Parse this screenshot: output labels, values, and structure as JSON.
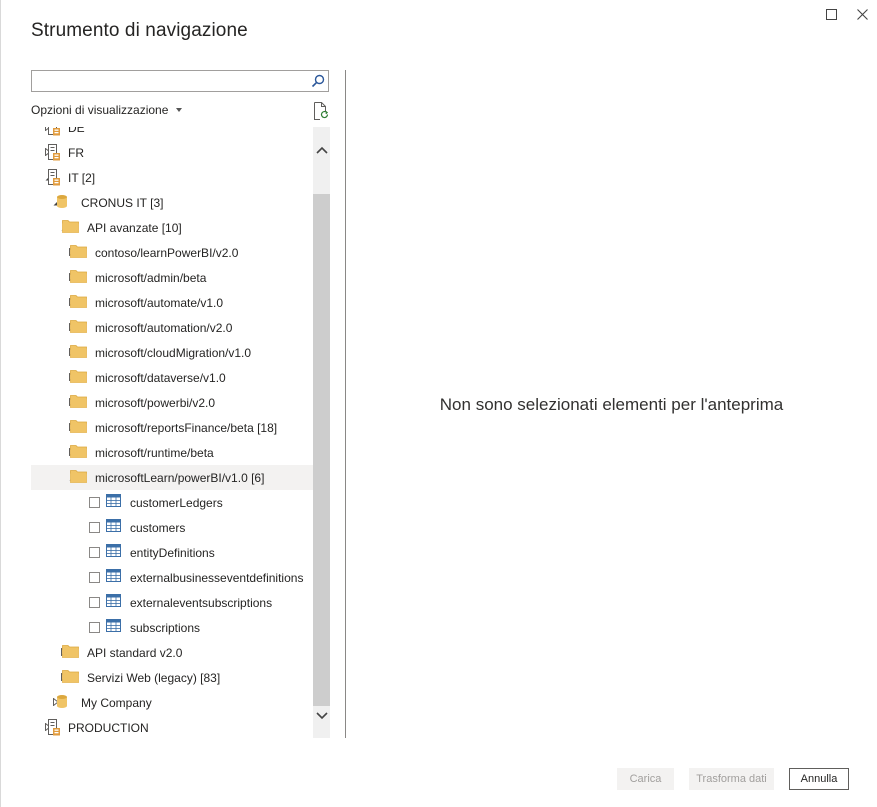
{
  "window": {
    "title": "Strumento di navigazione",
    "maximize_icon": "maximize-icon",
    "close_icon": "close-icon"
  },
  "search": {
    "placeholder": "",
    "value": "",
    "icon": "search-icon"
  },
  "view_options": {
    "label": "Opzioni di visualizzazione",
    "icon": "chevron-down-icon"
  },
  "refresh": {
    "icon": "refresh-document-icon"
  },
  "tree": {
    "rows": [
      {
        "label": "DE",
        "icon": "server-icon",
        "level": 0,
        "expander": "collapsed",
        "partial": true
      },
      {
        "label": "FR",
        "icon": "server-icon",
        "level": 0,
        "expander": "collapsed"
      },
      {
        "label": "IT [2]",
        "icon": "server-icon",
        "level": 0,
        "expander": "expanded"
      },
      {
        "label": "CRONUS IT [3]",
        "icon": "database-icon",
        "level": 1,
        "expander": "expanded"
      },
      {
        "label": "API avanzate [10]",
        "icon": "folder-icon",
        "level": 2,
        "expander": "expanded"
      },
      {
        "label": "contoso/learnPowerBI/v2.0",
        "icon": "folder-icon",
        "level": 3,
        "expander": "collapsed"
      },
      {
        "label": "microsoft/admin/beta",
        "icon": "folder-icon",
        "level": 3,
        "expander": "collapsed"
      },
      {
        "label": "microsoft/automate/v1.0",
        "icon": "folder-icon",
        "level": 3,
        "expander": "collapsed"
      },
      {
        "label": "microsoft/automation/v2.0",
        "icon": "folder-icon",
        "level": 3,
        "expander": "collapsed"
      },
      {
        "label": "microsoft/cloudMigration/v1.0",
        "icon": "folder-icon",
        "level": 3,
        "expander": "collapsed"
      },
      {
        "label": "microsoft/dataverse/v1.0",
        "icon": "folder-icon",
        "level": 3,
        "expander": "collapsed"
      },
      {
        "label": "microsoft/powerbi/v2.0",
        "icon": "folder-icon",
        "level": 3,
        "expander": "collapsed"
      },
      {
        "label": "microsoft/reportsFinance/beta [18]",
        "icon": "folder-icon",
        "level": 3,
        "expander": "collapsed"
      },
      {
        "label": "microsoft/runtime/beta",
        "icon": "folder-icon",
        "level": 3,
        "expander": "collapsed"
      },
      {
        "label": "microsoftLearn/powerBI/v1.0 [6]",
        "icon": "folder-icon",
        "level": 3,
        "expander": "expanded",
        "highlighted": true
      },
      {
        "label": "customerLedgers",
        "icon": "table-icon",
        "level": 4,
        "checkbox": true
      },
      {
        "label": "customers",
        "icon": "table-icon",
        "level": 4,
        "checkbox": true
      },
      {
        "label": "entityDefinitions",
        "icon": "table-icon",
        "level": 4,
        "checkbox": true
      },
      {
        "label": "externalbusinesseventdefinitions",
        "icon": "table-icon",
        "level": 4,
        "checkbox": true
      },
      {
        "label": "externaleventsubscriptions",
        "icon": "table-icon",
        "level": 4,
        "checkbox": true
      },
      {
        "label": "subscriptions",
        "icon": "table-icon",
        "level": 4,
        "checkbox": true
      },
      {
        "label": "API standard v2.0",
        "icon": "folder-icon",
        "level": 2,
        "expander": "collapsed"
      },
      {
        "label": "Servizi Web (legacy) [83]",
        "icon": "folder-icon",
        "level": 2,
        "expander": "collapsed"
      },
      {
        "label": "My Company",
        "icon": "database-icon",
        "level": 1,
        "expander": "collapsed"
      },
      {
        "label": "PRODUCTION",
        "icon": "server-icon",
        "level": 0,
        "expander": "collapsed"
      }
    ]
  },
  "scrollbar": {
    "up_icon": "chevron-up-icon",
    "down_icon": "chevron-down-icon"
  },
  "preview": {
    "message": "Non sono selezionati elementi per l'anteprima"
  },
  "buttons": {
    "load": "Carica",
    "transform": "Trasforma dati",
    "cancel": "Annulla"
  },
  "colors": {
    "folder": "#f0c466",
    "folder_dark": "#dca83f",
    "table_blue": "#3b6fa8",
    "server_orange": "#e09b3d",
    "highlight": "#f3f2f1"
  }
}
